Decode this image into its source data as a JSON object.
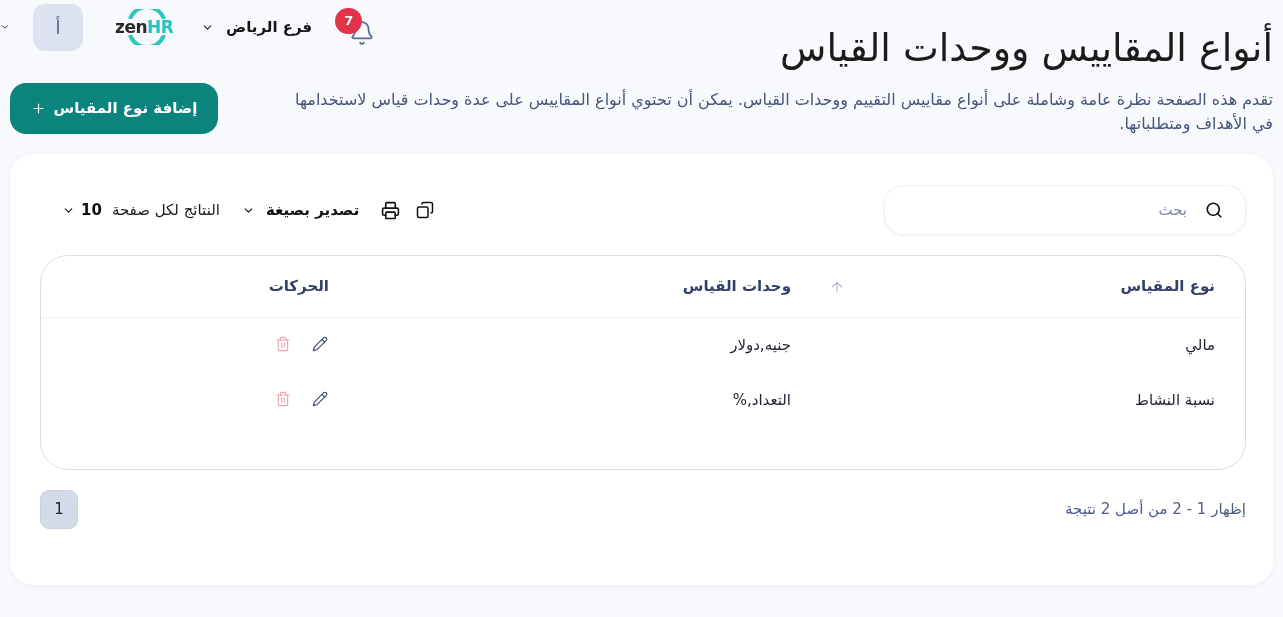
{
  "top_bar": {
    "notifications": {
      "count": "7"
    },
    "branch": {
      "label": "فرع الرياض"
    },
    "logo": {
      "text": "zen",
      "accent": "HR"
    },
    "user": {
      "initial": "أ"
    }
  },
  "page": {
    "title": "أنواع المقاييس ووحدات القياس",
    "description": "تقدم هذه الصفحة نظرة عامة وشاملة على أنواع مقاييس التقييم ووحدات القياس. يمكن أن تحتوي أنواع المقاييس على عدة وحدات قياس لاستخدامها في الأهداف ومتطلباتها.",
    "add_button": {
      "label": "إضافة نوع المقياس"
    }
  },
  "toolbar": {
    "search": {
      "placeholder": "بحث"
    },
    "export": {
      "label": "تصدير بصيغة"
    },
    "page_size": {
      "label": "النتائج لكل صفحة",
      "value": "10"
    }
  },
  "table": {
    "columns": [
      {
        "label": "نوع المقياس",
        "sorted_ascending": true
      },
      {
        "label": "وحدات القياس",
        "sorted_ascending": false
      },
      {
        "label": "الحركات",
        "sorted_ascending": false
      }
    ],
    "rows": [
      {
        "measure_type": "مالي",
        "units": "جنيه,دولار"
      },
      {
        "measure_type": "نسبة النشاط",
        "units": "التعداد,%"
      }
    ]
  },
  "pagination": {
    "summary": "إظهار 1 - 2 من أصل 2 نتيجة",
    "pages": [
      {
        "label": "1",
        "selected": true
      }
    ]
  }
}
